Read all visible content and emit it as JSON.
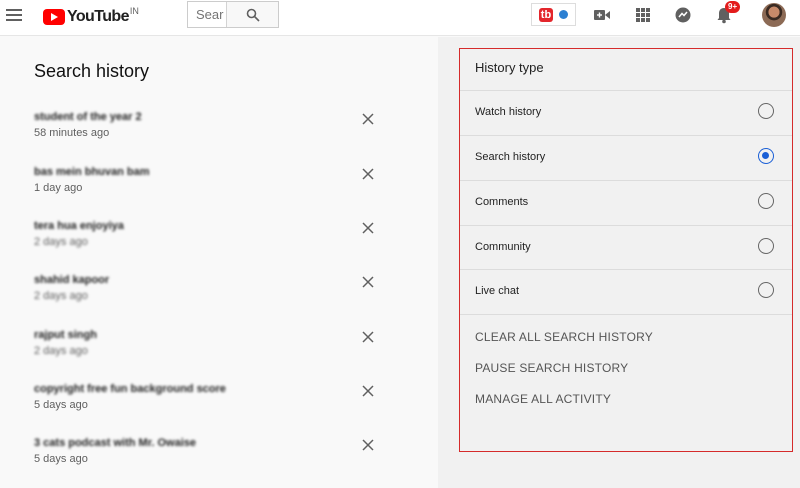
{
  "header": {
    "logo_text": "YouTube",
    "country_code": "IN",
    "search_placeholder": "Sear",
    "ext_badge_text": "tb",
    "notifications_count": "9+"
  },
  "history": {
    "title": "Search history",
    "items": [
      {
        "query": "student of the year 2",
        "time": "58 minutes ago",
        "time_blurred": false
      },
      {
        "query": "bas mein bhuvan bam",
        "time": "1 day ago",
        "time_blurred": false
      },
      {
        "query": "tera hua enjoyiya",
        "time": "2 days ago",
        "time_blurred": true
      },
      {
        "query": "shahid kapoor",
        "time": "2 days ago",
        "time_blurred": true
      },
      {
        "query": "rajput singh",
        "time": "2 days ago",
        "time_blurred": true
      },
      {
        "query": "copyright free fun background score",
        "time": "5 days ago",
        "time_blurred": false
      },
      {
        "query": "3 cats podcast with Mr. Owaise",
        "time": "5 days ago",
        "time_blurred": false
      }
    ]
  },
  "panel": {
    "title": "History type",
    "types": [
      {
        "label": "Watch history",
        "checked": false
      },
      {
        "label": "Search history",
        "checked": true
      },
      {
        "label": "Comments",
        "checked": false
      },
      {
        "label": "Community",
        "checked": false
      },
      {
        "label": "Live chat",
        "checked": false
      }
    ],
    "actions": [
      "CLEAR ALL SEARCH HISTORY",
      "PAUSE SEARCH HISTORY",
      "MANAGE ALL ACTIVITY"
    ]
  },
  "colors": {
    "brand": "#ff0000",
    "selected_radio": "#1a5fd6",
    "panel_border": "#d52b2b"
  }
}
